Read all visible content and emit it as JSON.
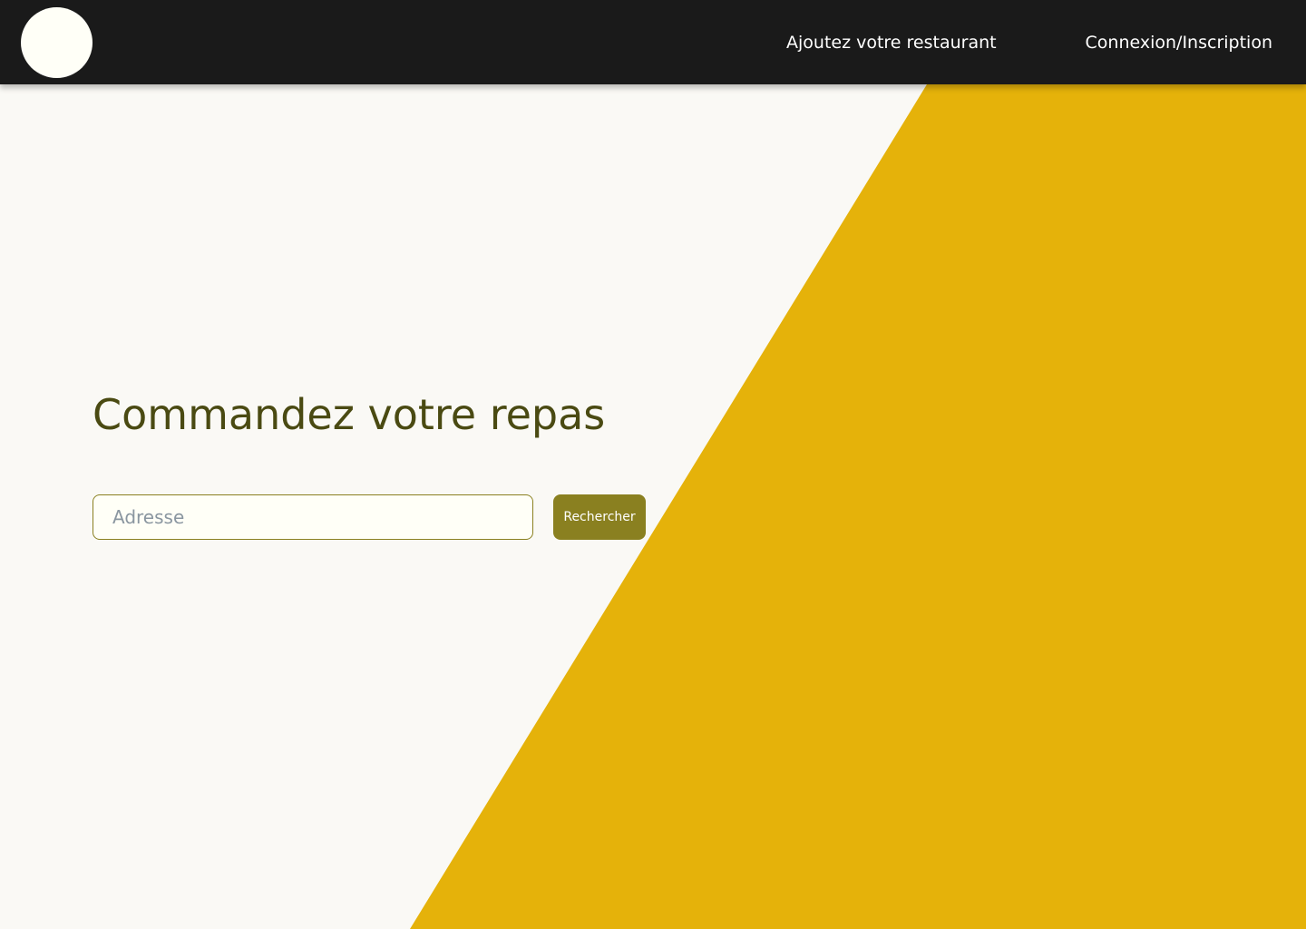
{
  "header": {
    "nav": {
      "add_restaurant": "Ajoutez votre restaurant",
      "login_signup": "Connexion/Inscription"
    }
  },
  "hero": {
    "title": "Commandez votre repas",
    "search": {
      "placeholder": "Adresse",
      "value": "",
      "button_label": "Rechercher"
    }
  },
  "colors": {
    "header_background": "#1A1A1A",
    "page_background": "#FAF9F5",
    "accent_yellow": "#E5B20A",
    "olive_button": "#8A8020",
    "title_text": "#4A4A12",
    "logo_fill": "#FFFFF7"
  }
}
